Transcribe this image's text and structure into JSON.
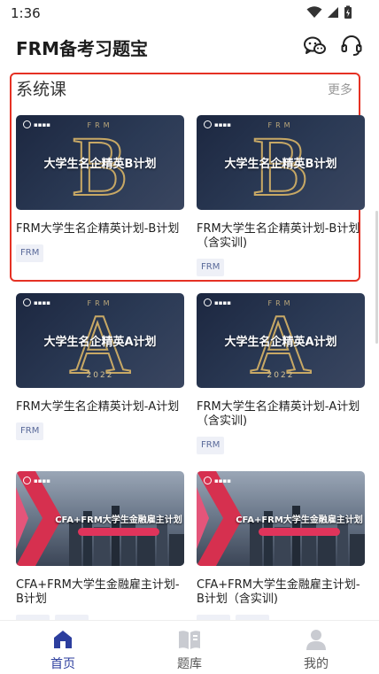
{
  "status": {
    "time": "1:36"
  },
  "header": {
    "title": "FRM备考习题宝"
  },
  "section": {
    "title": "系统课",
    "more": "更多"
  },
  "cards": [
    {
      "thumb_caption": "大学生名企精英B计划",
      "letter": "B",
      "frm": "FRM",
      "title": "FRM大学生名企精英计划-B计划",
      "tags": [
        "FRM"
      ]
    },
    {
      "thumb_caption": "大学生名企精英B计划",
      "letter": "B",
      "frm": "FRM",
      "title": "FRM大学生名企精英计划-B计划（含实训)",
      "tags": [
        "FRM"
      ]
    },
    {
      "thumb_caption": "大学生名企精英A计划",
      "letter": "A",
      "frm": "FRM",
      "year": "2022",
      "title": "FRM大学生名企精英计划-A计划",
      "tags": [
        "FRM"
      ]
    },
    {
      "thumb_caption": "大学生名企精英A计划",
      "letter": "A",
      "frm": "FRM",
      "year": "2022",
      "title": "FRM大学生名企精英计划-A计划（含实训)",
      "tags": [
        "FRM"
      ]
    },
    {
      "thumb_caption": "CFA+FRM大学生金融雇主计划",
      "title": "CFA+FRM大学生金融雇主计划-B计划",
      "tags": [
        "",
        ""
      ]
    },
    {
      "thumb_caption": "CFA+FRM大学生金融雇主计划",
      "title": "CFA+FRM大学生金融雇主计划-B计划（含实训)",
      "tags": [
        "",
        ""
      ]
    }
  ],
  "tabbar": {
    "items": [
      {
        "label": "首页",
        "icon": "home-icon",
        "active": true
      },
      {
        "label": "题库",
        "icon": "book-icon",
        "active": false
      },
      {
        "label": "我的",
        "icon": "person-icon",
        "active": false
      }
    ]
  },
  "colors": {
    "accent": "#2c3e9e",
    "highlight": "#e53124",
    "tag_bg": "#eef0f7"
  }
}
